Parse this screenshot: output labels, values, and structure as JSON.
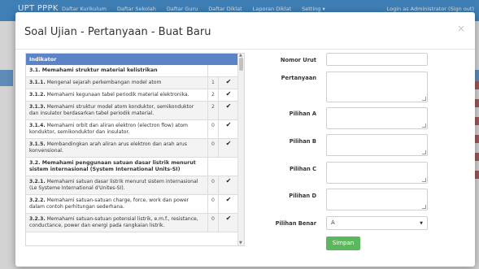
{
  "app": {
    "brand": "UPT PPPK",
    "menu": [
      "Daftar Kurikulum",
      "Daftar Sekolah",
      "Daftar Guru",
      "Daftar Diklat",
      "Laporan Diklat",
      "Setting ▾"
    ],
    "login": "Login as Administrator (Sign out)"
  },
  "modal": {
    "title": "Soal Ujian - Pertanyaan - Buat Baru",
    "close": "×"
  },
  "table": {
    "header": "Indikator",
    "rows": [
      {
        "type": "section",
        "text": "3.1. Memahami struktur material kelistrikan"
      },
      {
        "type": "item",
        "code": "3.1.1.",
        "text": "Mengenal sejarah perkembangan model atom",
        "count": "1",
        "check": "✔"
      },
      {
        "type": "item",
        "code": "3.1.2.",
        "text": "Memahami kegunaan tabel periodik material elektronika.",
        "count": "2",
        "check": "✔"
      },
      {
        "type": "item",
        "code": "3.1.3.",
        "text": "Memahami struktur model atom konduktor, semikonduktor dan insulator berdasarkan tabel periodik material.",
        "count": "2",
        "check": "✔"
      },
      {
        "type": "item",
        "code": "3.1.4.",
        "text": "Memahami orbit dan aliran elektron (electron flow) atom konduktor, semikonduktor dan insulator.",
        "count": "0",
        "check": "✔"
      },
      {
        "type": "item",
        "code": "3.1.5.",
        "text": "Membandingkan arah aliran arus elektron dan arah arus konvensional.",
        "count": "0",
        "check": "✔"
      },
      {
        "type": "section",
        "text": "3.2. Memahami penggunaan satuan dasar listrik menurut sistem internasional (System International Units-SI)"
      },
      {
        "type": "item",
        "code": "3.2.1.",
        "text": "Memahami satuan dasar listrik menurut sistem internasional (Le Systeme International d'Unites-SI).",
        "count": "0",
        "check": "✔"
      },
      {
        "type": "item",
        "code": "3.2.2.",
        "text": "Memahami satuan-satuan charge, force, work dan power dalam contoh perhitungan sederhana.",
        "count": "0",
        "check": "✔"
      },
      {
        "type": "item",
        "code": "3.2.3.",
        "text": "Memahami satuan-satuan potensial listrik, e.m.f., resistance, conductance, power dan energi pada rangkaian listrik.",
        "count": "0",
        "check": "✔"
      }
    ]
  },
  "form": {
    "nomor_urut": "Nomor Urut",
    "pertanyaan": "Pertanyaan",
    "pilihan_a": "Pilihan A",
    "pilihan_b": "Pilihan B",
    "pilihan_c": "Pilihan C",
    "pilihan_d": "Pilihan D",
    "pilihan_benar": "Pilihan Benar",
    "pilihan_benar_value": "A",
    "save": "Simpan"
  }
}
